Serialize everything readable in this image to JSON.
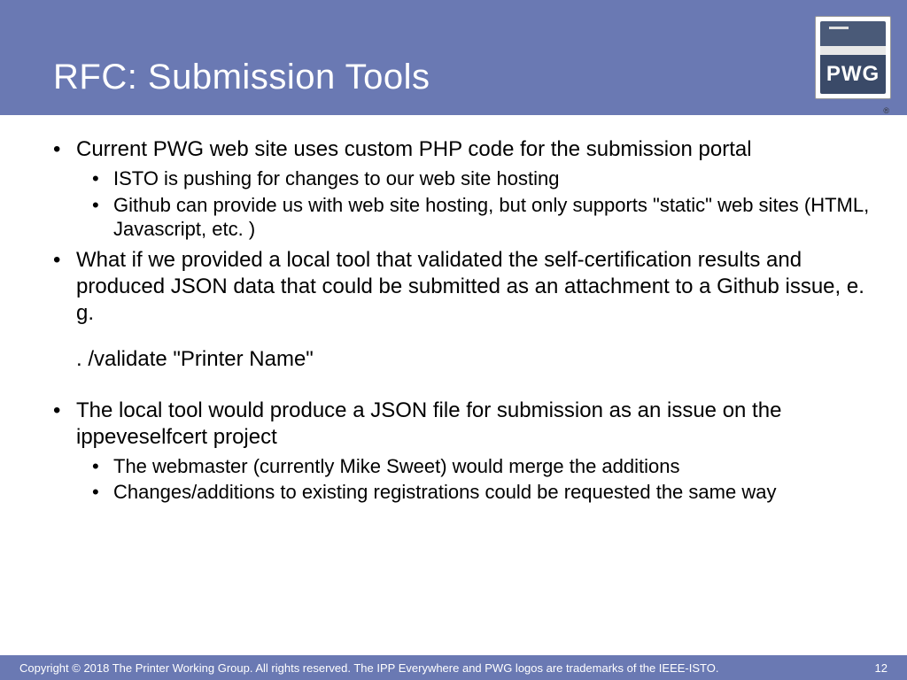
{
  "header": {
    "title": "RFC: Submission Tools",
    "logo_text": "PWG",
    "registered": "®"
  },
  "bullets": [
    {
      "text": "Current PWG web site uses custom PHP code for the submission portal",
      "children": [
        "ISTO is pushing for changes to our web site hosting",
        "Github can provide us with web site hosting, but only supports \"static\" web sites (HTML, Javascript, etc. )"
      ]
    },
    {
      "text": "What if we provided a local tool that validated the self-certification results and produced JSON data that could be submitted as an attachment to a Github issue, e. g.",
      "code": ". /validate \"Printer Name\""
    },
    {
      "text": "The local tool would produce a JSON file for submission as an issue on the ippeveselfcert project",
      "children": [
        "The webmaster (currently Mike Sweet) would merge the additions",
        "Changes/additions to existing registrations could be requested the same way"
      ]
    }
  ],
  "footer": {
    "copyright": "Copyright © 2018 The Printer Working Group. All rights reserved. The IPP Everywhere and PWG logos are trademarks of the IEEE-ISTO.",
    "page": "12"
  }
}
